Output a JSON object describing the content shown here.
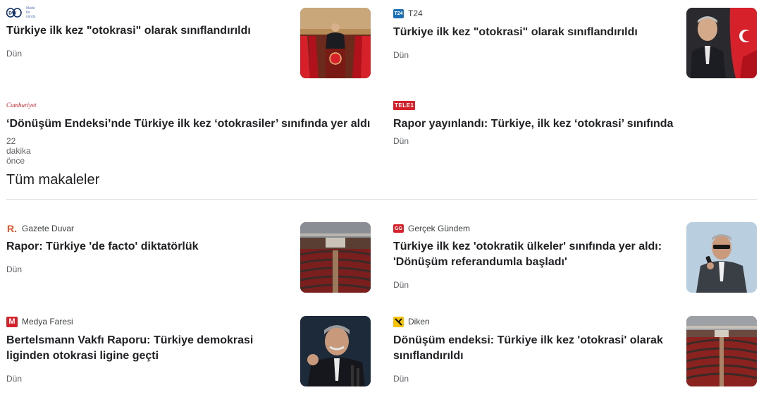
{
  "top_stories": [
    {
      "source": {
        "name": "",
        "logo_text": "DW",
        "logo_tagline": "Made for minds",
        "logo_icon": "dw-logo-icon"
      },
      "headline": "Türkiye ilk kez \"otokrasi\" olarak sınıflandırıldı",
      "time": "Dün",
      "thumbnail": "erdogan-podium-thumbnail"
    },
    {
      "source": {
        "name": "T24",
        "logo_text": "T24",
        "logo_icon": "t24-logo-icon"
      },
      "headline": "Türkiye ilk kez \"otokrasi\" olarak sınıflandırıldı",
      "time": "Dün",
      "thumbnail": "erdogan-flags-thumbnail"
    },
    {
      "source": {
        "name": "",
        "logo_text": "Cumhuriyet",
        "logo_icon": "cumhuriyet-logo-icon"
      },
      "headline": "‘Dönüşüm Endeksi’nde Türkiye ilk kez ‘otokrasiler’ sınıfında yer aldı",
      "time": "22 dakika önce"
    },
    {
      "source": {
        "name": "",
        "logo_text": "TELE1",
        "logo_icon": "tele1-logo-icon"
      },
      "headline": "Rapor yayınlandı: Türkiye, ilk kez ‘otokrasi’ sınıfında",
      "time": "Dün"
    }
  ],
  "section": {
    "title": "Tüm makaleler"
  },
  "all_articles": [
    {
      "source": {
        "name": "Gazete Duvar",
        "logo_text": "R.",
        "logo_icon": "gazete-duvar-logo-icon"
      },
      "headline": "Rapor: Türkiye 'de facto' diktatörlük",
      "time": "Dün",
      "thumbnail": "parliament-thumbnail"
    },
    {
      "source": {
        "name": "Gerçek Gündem",
        "logo_text": "GG",
        "logo_icon": "gercek-gundem-logo-icon"
      },
      "headline": "Türkiye ilk kez 'otokratik ülkeler' sınıfında yer aldı: 'Dönüşüm referandumla başladı'",
      "time": "Dün",
      "thumbnail": "erdogan-microphone-thumbnail"
    },
    {
      "source": {
        "name": "Medya Faresi",
        "logo_text": "M",
        "logo_icon": "medya-faresi-logo-icon"
      },
      "headline": "Bertelsmann Vakfı Raporu: Türkiye demokrasi liginden otokrasi ligine geçti",
      "time": "Dün",
      "thumbnail": "erdogan-speech-thumbnail"
    },
    {
      "source": {
        "name": "Diken",
        "logo_text": "",
        "logo_icon": "diken-logo-icon"
      },
      "headline": "Dönüşüm endeksi: Türkiye ilk kez 'otokrasi' olarak sınıflandırıldı",
      "time": "Dün",
      "thumbnail": "parliament-wide-thumbnail"
    }
  ],
  "colors": {
    "headline": "#202124",
    "meta": "#5f6368",
    "divider": "#dadce0",
    "turkish_red": "#d6202a",
    "duvar_orange": "#e5542b",
    "diken_yellow": "#f4c400"
  }
}
